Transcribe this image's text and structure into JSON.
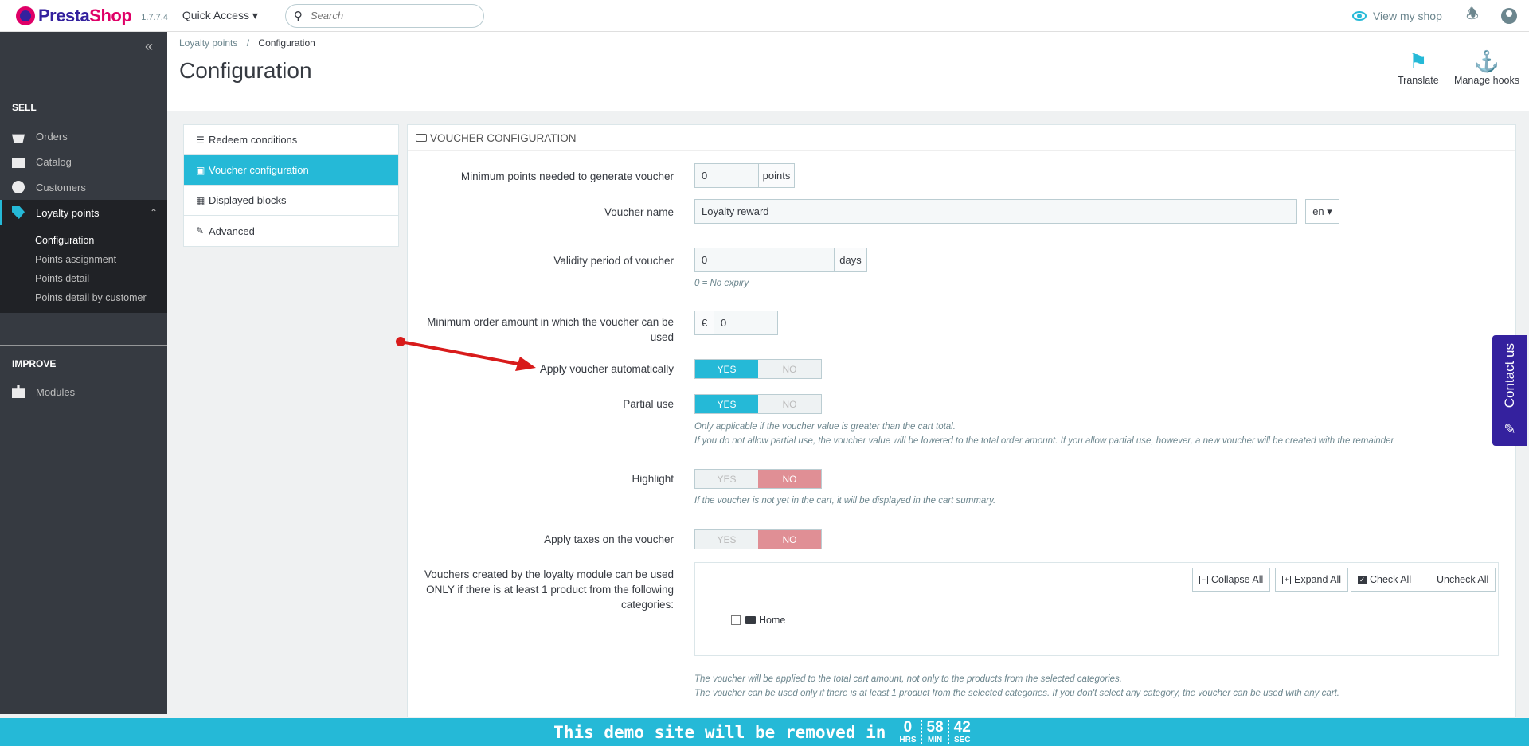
{
  "header": {
    "brand_main": "Presta",
    "brand_accent": "Shop",
    "version": "1.7.7.4",
    "quick_access": "Quick Access",
    "search_placeholder": "Search",
    "view_shop": "View my shop"
  },
  "sidebar": {
    "sell_title": "SELL",
    "items": [
      {
        "label": "Orders",
        "icon": "basket-icon"
      },
      {
        "label": "Catalog",
        "icon": "store-icon"
      },
      {
        "label": "Customers",
        "icon": "user-icon"
      },
      {
        "label": "Loyalty points",
        "icon": "tag-icon"
      }
    ],
    "sub_items": [
      "Configuration",
      "Points assignment",
      "Points detail",
      "Points detail by customer"
    ],
    "improve_title": "IMPROVE",
    "modules": "Modules"
  },
  "page": {
    "breadcrumb_parent": "Loyalty points",
    "breadcrumb_sep": "/",
    "breadcrumb_current": "Configuration",
    "title": "Configuration",
    "translate": "Translate",
    "manage_hooks": "Manage hooks"
  },
  "tabs": [
    "Redeem conditions",
    "Voucher configuration",
    "Displayed blocks",
    "Advanced"
  ],
  "form": {
    "heading": "VOUCHER CONFIGURATION",
    "min_points_label": "Minimum points needed to generate voucher",
    "min_points_value": "0",
    "min_points_addon": "points",
    "voucher_name_label": "Voucher name",
    "voucher_name_value": "Loyalty reward",
    "lang": "en",
    "validity_label": "Validity period of voucher",
    "validity_value": "0",
    "validity_addon": "days",
    "validity_help": "0 = No expiry",
    "min_order_label": "Minimum order amount in which the voucher can be used",
    "min_order_currency": "€",
    "min_order_value": "0",
    "apply_auto_label": "Apply voucher automatically",
    "partial_label": "Partial use",
    "partial_help_1": "Only applicable if the voucher value is greater than the cart total.",
    "partial_help_2": "If you do not allow partial use, the voucher value will be lowered to the total order amount. If you allow partial use, however, a new voucher will be created with the remainder",
    "highlight_label": "Highlight",
    "highlight_help": "If the voucher is not yet in the cart, it will be displayed in the cart summary.",
    "taxes_label": "Apply taxes on the voucher",
    "yes": "YES",
    "no": "NO",
    "categories_label": "Vouchers created by the loyalty module can be used ONLY if there is at least 1 product from the following categories:",
    "collapse_all": "Collapse All",
    "expand_all": "Expand All",
    "check_all": "Check All",
    "uncheck_all": "Uncheck All",
    "tree_home": "Home",
    "cat_help_1": "The voucher will be applied to the total cart amount, not only to the products from the selected categories.",
    "cat_help_2": "The voucher can be used only if there is at least 1 product from the selected categories. If you don't select any category, the voucher can be used with any cart."
  },
  "contact": "Contact us",
  "demo": {
    "text": "This demo site will be removed in",
    "hrs": "0",
    "hrs_unit": "HRS",
    "min": "58",
    "min_unit": "MIN",
    "sec": "42",
    "sec_unit": "SEC"
  },
  "colors": {
    "accent": "#25b9d7",
    "sidebar": "#363a41",
    "brand": "#df0067",
    "no_active": "#e08f95",
    "contact": "#34219e"
  }
}
